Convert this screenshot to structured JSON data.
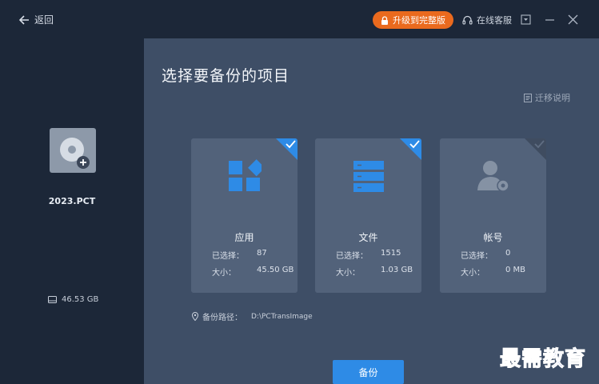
{
  "titlebar": {
    "back_label": "返回",
    "upgrade_label": "升级到完整版",
    "support_label": "在线客服"
  },
  "sidebar": {
    "drive_name": "2023.PCT",
    "capacity": "46.53 GB"
  },
  "main": {
    "title": "选择要备份的项目",
    "help_label": "迁移说明",
    "cards": [
      {
        "name": "应用",
        "selected_key": "已选择：",
        "selected_value": "87",
        "size_key": "大小：",
        "size_value": "45.50 GB",
        "checked": true,
        "icon": "apps-icon"
      },
      {
        "name": "文件",
        "selected_key": "已选择：",
        "selected_value": "1515",
        "size_key": "大小：",
        "size_value": "1.03 GB",
        "checked": true,
        "icon": "files-icon"
      },
      {
        "name": "帐号",
        "selected_key": "已选择：",
        "selected_value": "0",
        "size_key": "大小：",
        "size_value": "0 MB",
        "checked": false,
        "icon": "account-settings-icon"
      }
    ],
    "path_label": "备份路径：",
    "path_value": "D:\\PCTransImage",
    "backup_label": "备份"
  },
  "watermark": "最需教育",
  "colors": {
    "accent_blue": "#2e8be6",
    "upgrade_orange": "#ea6a1e",
    "card_bg": "#52627a",
    "panel_bg": "#3e4e66",
    "sidebar_bg": "#1c2738"
  }
}
